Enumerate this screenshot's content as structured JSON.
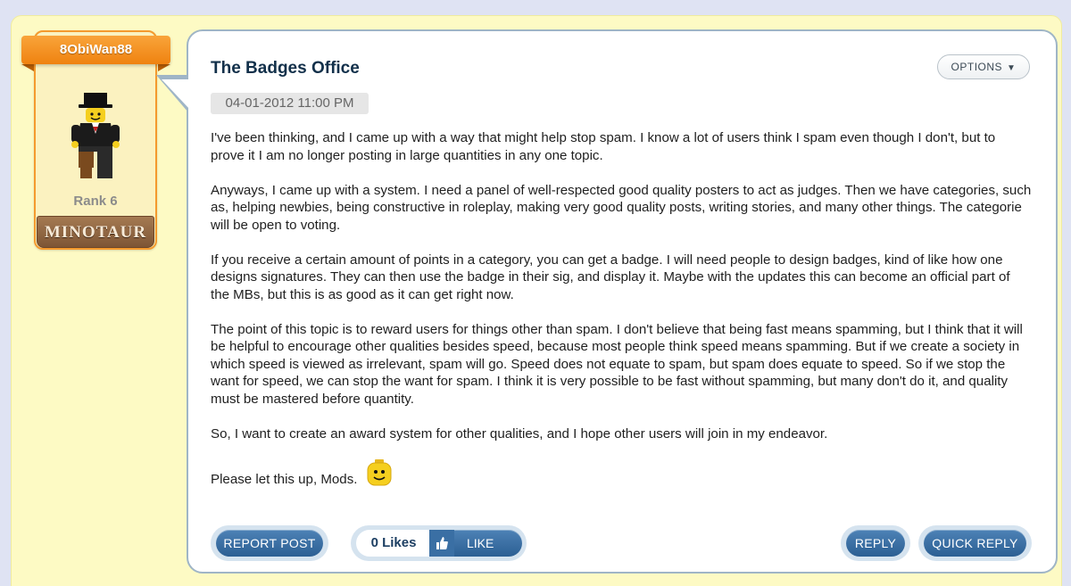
{
  "user": {
    "username": "8ObiWan88",
    "rank": "Rank 6",
    "rank_badge": "MINOTAUR",
    "avatar_icon": "lego-minifig-top-hat-icon"
  },
  "post": {
    "title": "The Badges Office",
    "date": "04-01-2012 11:00 PM",
    "options_label": "OPTIONS",
    "paragraphs": [
      "I've been thinking, and I came up with a way that might help stop spam. I know a lot of users think I spam even though I don't, but to prove it I am no longer posting in large quantities in any one topic.",
      "Anyways, I came up with a system. I need a panel of well-respected good quality posters to act as judges. Then we have categories, such as, helping newbies, being constructive in roleplay, making very good quality posts, writing stories, and many other things. The categorie will be open to voting.",
      "If you receive a certain amount of points in a category, you can get a badge. I will need people to design badges, kind of like how one designs signatures. They can then use the badge in their sig, and display it. Maybe with the updates this can become an official part of the MBs, but this is as good as it can get right now.",
      "The point of this topic is to reward users for things other than spam. I don't believe that being fast means spamming, but I think that it will be helpful to encourage other qualities besides speed, because most people think speed means spamming. But if we create a society in which speed is viewed as irrelevant, spam will go. Speed does not equate to spam, but spam does equate to speed. So if we stop the want for speed, we can stop the want for spam. I think it is very possible to be fast without spamming, but many don't do it, and quality must be mastered before quantity.",
      "So, I want to create an award system for other qualities, and I hope other users will join in my endeavor."
    ],
    "closing_line": "Please let this up, Mods.",
    "closing_emoji": "lego-smiley-icon"
  },
  "actions": {
    "report_label": "REPORT POST",
    "likes_count": "0 Likes",
    "like_label": "LIKE",
    "reply_label": "REPLY",
    "quick_reply_label": "QUICK REPLY"
  },
  "colors": {
    "accent_orange": "#ef8210",
    "button_blue": "#2c5f93",
    "title_navy": "#12304a",
    "page_yellow": "#fdfac4"
  }
}
